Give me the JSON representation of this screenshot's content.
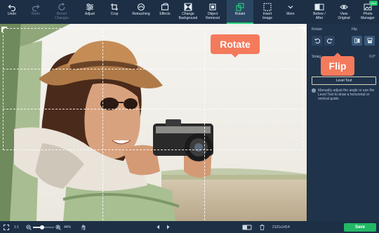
{
  "toolbar": {
    "tools": [
      {
        "label": "Undo",
        "icon": "undo-icon",
        "state": "normal"
      },
      {
        "label": "Redo",
        "icon": "redo-icon",
        "state": "disabled"
      },
      {
        "label": "Revert\nChanges",
        "icon": "revert-icon",
        "state": "disabled"
      },
      {
        "label": "Adjust",
        "icon": "sliders-icon",
        "state": "normal"
      },
      {
        "label": "Crop",
        "icon": "crop-icon",
        "state": "normal"
      },
      {
        "label": "Retouching",
        "icon": "retouch-icon",
        "state": "normal"
      },
      {
        "label": "Effects",
        "icon": "effects-icon",
        "state": "normal"
      },
      {
        "label": "Change\nBackground",
        "icon": "background-icon",
        "state": "normal"
      },
      {
        "label": "Object\nRemoval",
        "icon": "eraser-icon",
        "state": "normal"
      },
      {
        "label": "Rotate",
        "icon": "rotate-icon",
        "state": "active"
      },
      {
        "label": "Insert\nImage",
        "icon": "insert-image-icon",
        "state": "normal"
      },
      {
        "label": "More",
        "icon": "chevron-down-icon",
        "state": "normal"
      },
      {
        "label": "Before /\nAfter",
        "icon": "before-after-icon",
        "state": "normal"
      },
      {
        "label": "View\nOriginal",
        "icon": "eye-icon",
        "state": "normal"
      },
      {
        "label": "Photo\nManager",
        "icon": "photo-manager-icon",
        "state": "normal",
        "badge": "New"
      }
    ]
  },
  "callouts": {
    "rotate": "Rotate",
    "flip": "Flip"
  },
  "panel": {
    "rotate_label": "Rotate",
    "flip_label": "Flip",
    "straighten_label": "Straig",
    "straighten_value": "0.0°",
    "level_tool": "Level Tool",
    "hint": "Manually adjust the angle or use the Level Tool to draw a horizontal or vertical guide."
  },
  "bottom": {
    "ratio": "1:1",
    "zoom": "44%",
    "zoom_fraction": 0.44,
    "dimensions": "2121x1414",
    "save": "Save"
  },
  "colors": {
    "accent": "#22b865",
    "callout": "#f47a5c",
    "toolbar": "#1c2f45",
    "panel": "#1f334b"
  }
}
